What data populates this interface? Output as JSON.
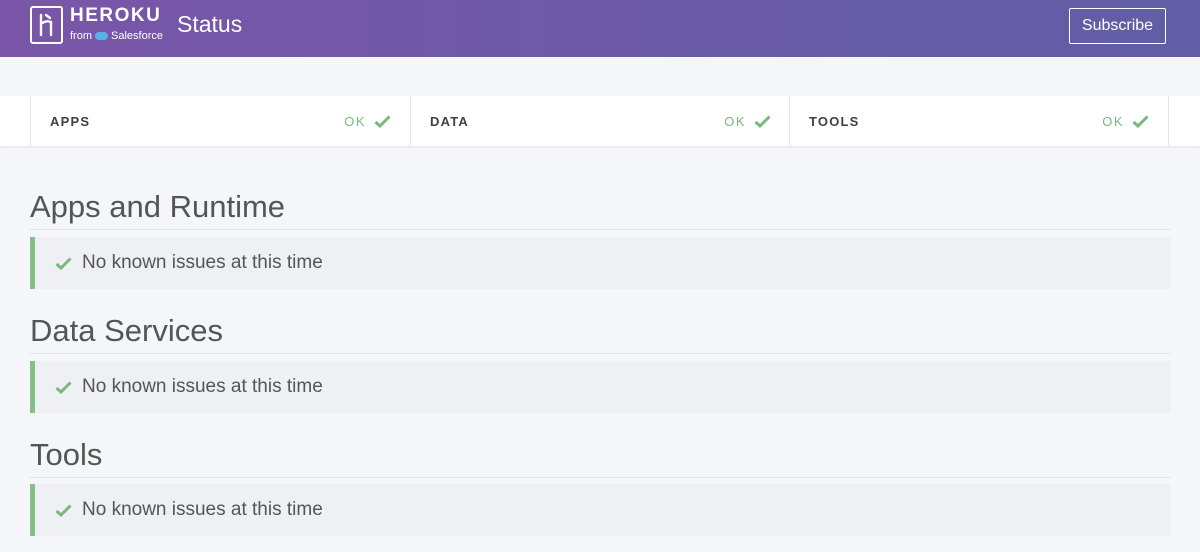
{
  "header": {
    "brand": "HEROKU",
    "brand_from": "from",
    "brand_partner": "Salesforce",
    "app_title": "Status",
    "subscribe_label": "Subscribe"
  },
  "status_bar": [
    {
      "name": "APPS",
      "status": "OK"
    },
    {
      "name": "DATA",
      "status": "OK"
    },
    {
      "name": "TOOLS",
      "status": "OK"
    }
  ],
  "sections": [
    {
      "title": "Apps and Runtime",
      "message": "No known issues at this time"
    },
    {
      "title": "Data Services",
      "message": "No known issues at this time"
    },
    {
      "title": "Tools",
      "message": "No known issues at this time"
    }
  ],
  "icons": {
    "logo": "heroku-logo-icon",
    "check": "checkmark-icon",
    "cloud": "salesforce-cloud-icon"
  },
  "colors": {
    "header_start": "#7a55a8",
    "header_end": "#615ea5",
    "ok_green": "#79b87e",
    "bar_green": "#84bf87"
  }
}
